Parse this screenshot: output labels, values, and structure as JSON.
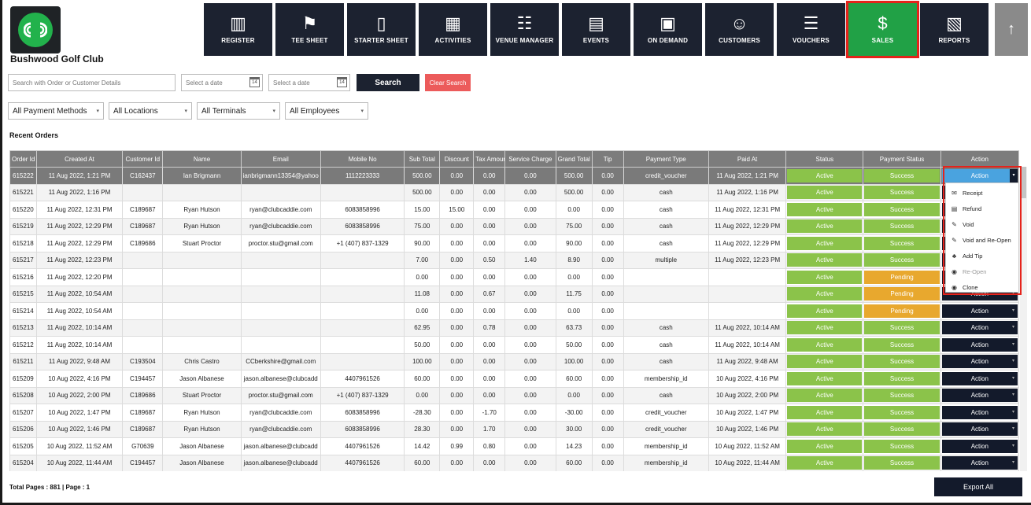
{
  "header": {
    "club_name": "Bushwood Golf Club",
    "nav": [
      {
        "label": "REGISTER",
        "icon": "barcode-scanner-icon",
        "glyph": "▥"
      },
      {
        "label": "TEE SHEET",
        "icon": "tee-sheet-icon",
        "glyph": "⚑"
      },
      {
        "label": "STARTER SHEET",
        "icon": "tablet-icon",
        "glyph": "▯"
      },
      {
        "label": "ACTIVITIES",
        "icon": "calendar-list-icon",
        "glyph": "▦"
      },
      {
        "label": "VENUE MANAGER",
        "icon": "group-icon",
        "glyph": "☷"
      },
      {
        "label": "EVENTS",
        "icon": "calendar-edit-icon",
        "glyph": "▤"
      },
      {
        "label": "ON DEMAND",
        "icon": "phone-person-icon",
        "glyph": "▣"
      },
      {
        "label": "CUSTOMERS",
        "icon": "customers-icon",
        "glyph": "☺"
      },
      {
        "label": "VOUCHERS",
        "icon": "voucher-list-icon",
        "glyph": "☰"
      },
      {
        "label": "SALES",
        "icon": "sales-money-icon",
        "glyph": "$",
        "active": true
      },
      {
        "label": "REPORTS",
        "icon": "reports-chart-icon",
        "glyph": "▧"
      }
    ],
    "up_glyph": "↑"
  },
  "filters": {
    "search_placeholder": "Search with Order or Customer Details",
    "date_placeholder_1": "Select a date",
    "date_placeholder_2": "Select a date",
    "calendar_glyph": "14",
    "search_label": "Search",
    "clear_label": "Clear Search",
    "payment_methods": "All Payment Methods",
    "locations": "All Locations",
    "terminals": "All Terminals",
    "employees": "All Employees",
    "caret": "▾"
  },
  "section_title": "Recent Orders",
  "table": {
    "columns": [
      "Order Id",
      "Created At",
      "Customer Id",
      "Name",
      "Email",
      "Mobile No",
      "Sub Total",
      "Discount",
      "Tax Amount",
      "Service Charge",
      "Grand Total",
      "Tip",
      "Payment Type",
      "Paid At",
      "Status",
      "Payment Status",
      "Action"
    ],
    "action_label": "Action",
    "rows": [
      [
        "615222",
        "11 Aug 2022, 1:21 PM",
        "C162437",
        "Ian Brigmann",
        "ianbrigmann13354@yahoo",
        "1112223333",
        "500.00",
        "0.00",
        "0.00",
        "0.00",
        "500.00",
        "0.00",
        "credit_voucher",
        "11 Aug 2022, 1:21 PM",
        "Active",
        "Success"
      ],
      [
        "615221",
        "11 Aug 2022, 1:16 PM",
        "",
        "",
        "",
        "",
        "500.00",
        "0.00",
        "0.00",
        "0.00",
        "500.00",
        "0.00",
        "cash",
        "11 Aug 2022, 1:16 PM",
        "Active",
        "Success"
      ],
      [
        "615220",
        "11 Aug 2022, 12:31 PM",
        "C189687",
        "Ryan Hutson",
        "ryan@clubcaddie.com",
        "6083858996",
        "15.00",
        "15.00",
        "0.00",
        "0.00",
        "0.00",
        "0.00",
        "cash",
        "11 Aug 2022, 12:31 PM",
        "Active",
        "Success"
      ],
      [
        "615219",
        "11 Aug 2022, 12:29 PM",
        "C189687",
        "Ryan Hutson",
        "ryan@clubcaddie.com",
        "6083858996",
        "75.00",
        "0.00",
        "0.00",
        "0.00",
        "75.00",
        "0.00",
        "cash",
        "11 Aug 2022, 12:29 PM",
        "Active",
        "Success"
      ],
      [
        "615218",
        "11 Aug 2022, 12:29 PM",
        "C189686",
        "Stuart Proctor",
        "proctor.stu@gmail.com",
        "+1 (407) 837-1329",
        "90.00",
        "0.00",
        "0.00",
        "0.00",
        "90.00",
        "0.00",
        "cash",
        "11 Aug 2022, 12:29 PM",
        "Active",
        "Success"
      ],
      [
        "615217",
        "11 Aug 2022, 12:23 PM",
        "",
        "",
        "",
        "",
        "7.00",
        "0.00",
        "0.50",
        "1.40",
        "8.90",
        "0.00",
        "multiple",
        "11 Aug 2022, 12:23 PM",
        "Active",
        "Success"
      ],
      [
        "615216",
        "11 Aug 2022, 12:20 PM",
        "",
        "",
        "",
        "",
        "0.00",
        "0.00",
        "0.00",
        "0.00",
        "0.00",
        "0.00",
        "",
        "",
        "Active",
        "Pending"
      ],
      [
        "615215",
        "11 Aug 2022, 10:54 AM",
        "",
        "",
        "",
        "",
        "11.08",
        "0.00",
        "0.67",
        "0.00",
        "11.75",
        "0.00",
        "",
        "",
        "Active",
        "Pending"
      ],
      [
        "615214",
        "11 Aug 2022, 10:54 AM",
        "",
        "",
        "",
        "",
        "0.00",
        "0.00",
        "0.00",
        "0.00",
        "0.00",
        "0.00",
        "",
        "",
        "Active",
        "Pending"
      ],
      [
        "615213",
        "11 Aug 2022, 10:14 AM",
        "",
        "",
        "",
        "",
        "62.95",
        "0.00",
        "0.78",
        "0.00",
        "63.73",
        "0.00",
        "cash",
        "11 Aug 2022, 10:14 AM",
        "Active",
        "Success"
      ],
      [
        "615212",
        "11 Aug 2022, 10:14 AM",
        "",
        "",
        "",
        "",
        "50.00",
        "0.00",
        "0.00",
        "0.00",
        "50.00",
        "0.00",
        "cash",
        "11 Aug 2022, 10:14 AM",
        "Active",
        "Success"
      ],
      [
        "615211",
        "11 Aug 2022, 9:48 AM",
        "C193504",
        "Chris Castro",
        "CCberkshire@gmail.com",
        "",
        "100.00",
        "0.00",
        "0.00",
        "0.00",
        "100.00",
        "0.00",
        "cash",
        "11 Aug 2022, 9:48 AM",
        "Active",
        "Success"
      ],
      [
        "615209",
        "10 Aug 2022, 4:16 PM",
        "C194457",
        "Jason Albanese",
        "jason.albanese@clubcadd",
        "4407961526",
        "60.00",
        "0.00",
        "0.00",
        "0.00",
        "60.00",
        "0.00",
        "membership_id",
        "10 Aug 2022, 4:16 PM",
        "Active",
        "Success"
      ],
      [
        "615208",
        "10 Aug 2022, 2:00 PM",
        "C189686",
        "Stuart Proctor",
        "proctor.stu@gmail.com",
        "+1 (407) 837-1329",
        "0.00",
        "0.00",
        "0.00",
        "0.00",
        "0.00",
        "0.00",
        "cash",
        "10 Aug 2022, 2:00 PM",
        "Active",
        "Success"
      ],
      [
        "615207",
        "10 Aug 2022, 1:47 PM",
        "C189687",
        "Ryan Hutson",
        "ryan@clubcaddie.com",
        "6083858996",
        "-28.30",
        "0.00",
        "-1.70",
        "0.00",
        "-30.00",
        "0.00",
        "credit_voucher",
        "10 Aug 2022, 1:47 PM",
        "Active",
        "Success"
      ],
      [
        "615206",
        "10 Aug 2022, 1:46 PM",
        "C189687",
        "Ryan Hutson",
        "ryan@clubcaddie.com",
        "6083858996",
        "28.30",
        "0.00",
        "1.70",
        "0.00",
        "30.00",
        "0.00",
        "credit_voucher",
        "10 Aug 2022, 1:46 PM",
        "Active",
        "Success"
      ],
      [
        "615205",
        "10 Aug 2022, 11:52 AM",
        "G70639",
        "Jason Albanese",
        "jason.albanese@clubcadd",
        "4407961526",
        "14.42",
        "0.99",
        "0.80",
        "0.00",
        "14.23",
        "0.00",
        "membership_id",
        "10 Aug 2022, 11:52 AM",
        "Active",
        "Success"
      ],
      [
        "615204",
        "10 Aug 2022, 11:44 AM",
        "C194457",
        "Jason Albanese",
        "jason.albanese@clubcadd",
        "4407961526",
        "60.00",
        "0.00",
        "0.00",
        "0.00",
        "60.00",
        "0.00",
        "membership_id",
        "10 Aug 2022, 11:44 AM",
        "Active",
        "Success"
      ]
    ]
  },
  "action_menu": [
    {
      "label": "Receipt",
      "icon": "receipt-icon",
      "glyph": "✉"
    },
    {
      "label": "Refund",
      "icon": "refund-icon",
      "glyph": "▤"
    },
    {
      "label": "Void",
      "icon": "void-wrench-icon",
      "glyph": "✎"
    },
    {
      "label": "Void and Re-Open",
      "icon": "void-reopen-icon",
      "glyph": "✎"
    },
    {
      "label": "Add Tip",
      "icon": "add-tip-icon",
      "glyph": "♣"
    },
    {
      "label": "Re-Open",
      "icon": "reopen-eye-icon",
      "glyph": "◉",
      "disabled": true
    },
    {
      "label": "Clone",
      "icon": "clone-eye-icon",
      "glyph": "◉"
    }
  ],
  "footer": {
    "pages_text": "Total Pages : 881 | Page : 1",
    "export_label": "Export All"
  },
  "colors": {
    "nav_bg": "#1c2230",
    "active_green": "#21a146",
    "highlight_red": "#e5231b",
    "status_green": "#8bc34a",
    "pending_orange": "#e8a82e",
    "action_navy": "#131a2b",
    "action_open_blue": "#4aa3df",
    "clear_red": "#ec5b5b"
  }
}
